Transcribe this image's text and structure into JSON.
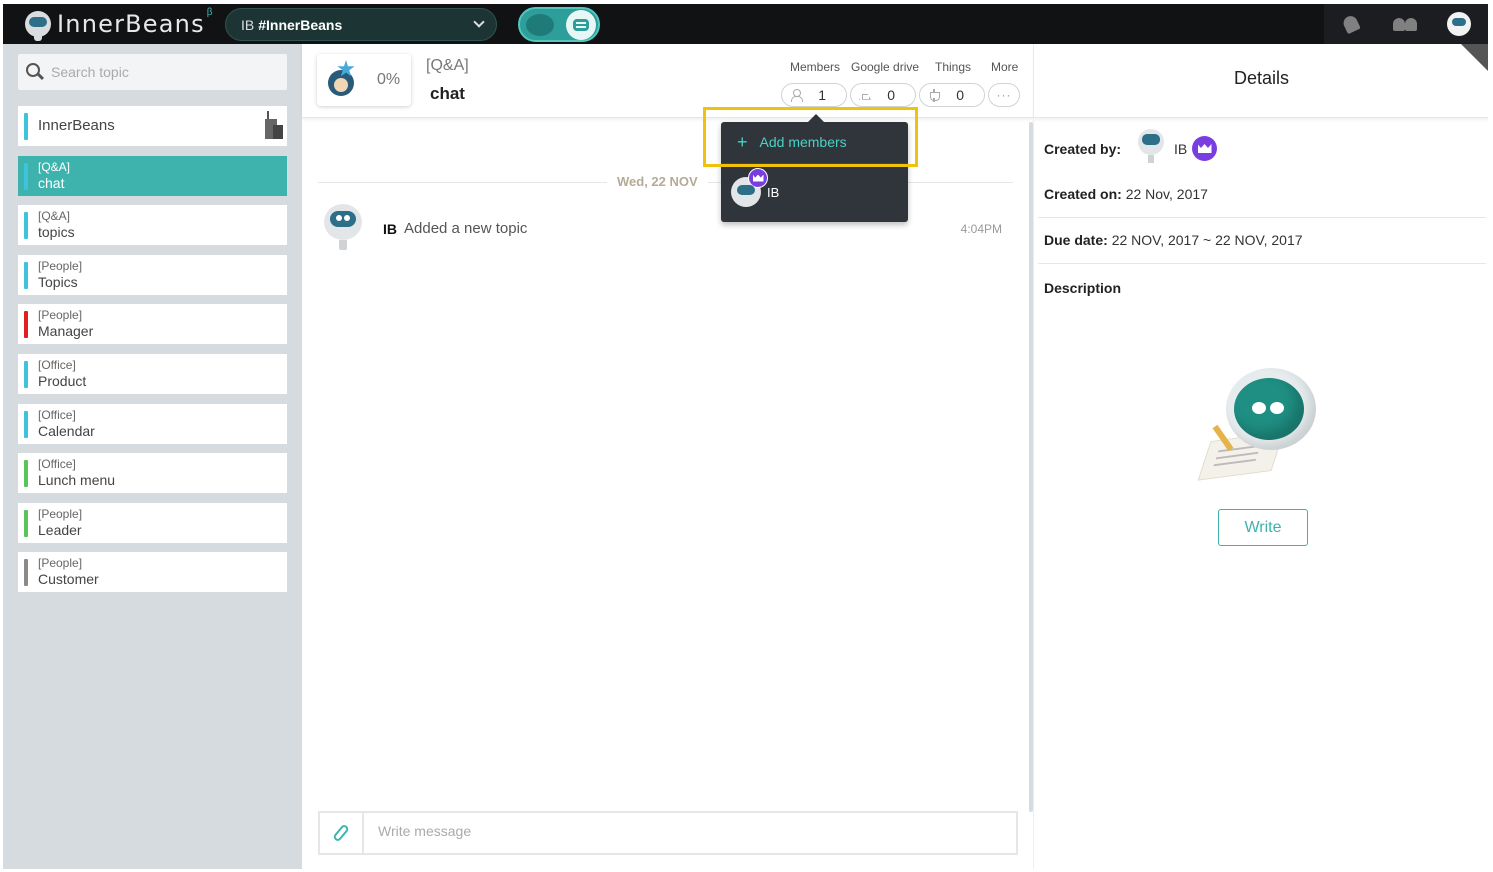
{
  "app": {
    "name": "InnerBeans",
    "beta": "β"
  },
  "workspace": {
    "prefix": "IB",
    "name": "#InnerBeans"
  },
  "sidebar": {
    "search_placeholder": "Search topic",
    "topics": [
      {
        "tag": "",
        "title": "InnerBeans",
        "color": "#3dc3dc",
        "active": false
      },
      {
        "tag": "[Q&A]",
        "title": "chat",
        "color": "#3dc3dc",
        "active": true
      },
      {
        "tag": "[Q&A]",
        "title": "topics",
        "color": "#3dc3dc",
        "active": false
      },
      {
        "tag": "[People]",
        "title": "Topics",
        "color": "#3dc3dc",
        "active": false
      },
      {
        "tag": "[People]",
        "title": "Manager",
        "color": "#e02020",
        "active": false
      },
      {
        "tag": "[Office]",
        "title": "Product",
        "color": "#3dc3dc",
        "active": false
      },
      {
        "tag": "[Office]",
        "title": "Calendar",
        "color": "#3dc3dc",
        "active": false
      },
      {
        "tag": "[Office]",
        "title": "Lunch menu",
        "color": "#5ac35a",
        "active": false
      },
      {
        "tag": "[People]",
        "title": "Leader",
        "color": "#5ac35a",
        "active": false
      },
      {
        "tag": "[People]",
        "title": "Customer",
        "color": "#8a8a8a",
        "active": false
      }
    ]
  },
  "topic_header": {
    "progress": "0%",
    "tag": "[Q&A]",
    "title": "chat",
    "stats": {
      "members_label": "Members",
      "members_count": "1",
      "drive_label": "Google drive",
      "drive_count": "0",
      "things_label": "Things",
      "things_count": "0",
      "more_label": "More",
      "more_icon": "···"
    }
  },
  "chat": {
    "date_separator": "Wed, 22 NOV",
    "messages": [
      {
        "author": "IB",
        "text": "Added a new topic",
        "time": "4:04PM"
      }
    ],
    "composer_placeholder": "Write message"
  },
  "members_popup": {
    "add_label": "Add members",
    "add_icon": "+",
    "members": [
      {
        "name": "IB",
        "is_owner": true
      }
    ]
  },
  "details": {
    "title": "Details",
    "created_by_label": "Created by:",
    "created_by": "IB",
    "created_on_label": "Created on:",
    "created_on": "22 Nov, 2017",
    "due_date_label": "Due date:",
    "due_date": "22 NOV, 2017 ~ 22 NOV, 2017",
    "description_label": "Description",
    "write_button": "Write"
  },
  "colors": {
    "accent": "#3eb3ae",
    "topbar": "#111214",
    "sidebar": "#d5dbdf",
    "owner_badge": "#7a3ee0",
    "highlight": "#f0c20a"
  }
}
